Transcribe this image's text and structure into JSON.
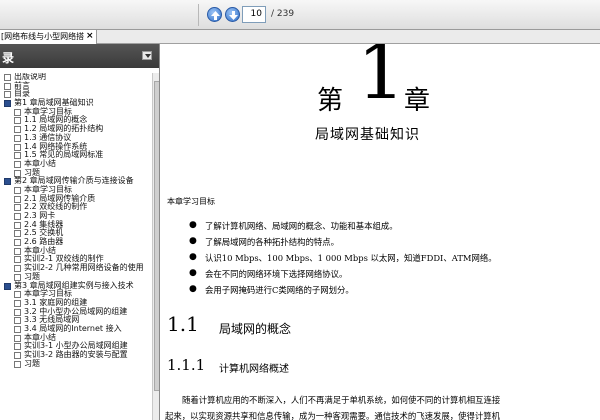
{
  "toolbar": {
    "current_page": "10",
    "page_total": "/ 239"
  },
  "tab": {
    "title": "[网络布线与小型网络搭建]...",
    "close_glyph": "×"
  },
  "sidebar": {
    "title": "录",
    "menu_icon": "triangle-down-icon",
    "items": [
      {
        "label": "出版说明",
        "level": 0,
        "expanded": false
      },
      {
        "label": "前言",
        "level": 0,
        "expanded": false
      },
      {
        "label": "目录",
        "level": 0,
        "expanded": false
      },
      {
        "label": "第1 章局域网基础知识",
        "level": 0,
        "expanded": true
      },
      {
        "label": "本章学习目标",
        "level": 1,
        "expanded": false
      },
      {
        "label": "1.1 局域网的概念",
        "level": 1,
        "expanded": false
      },
      {
        "label": "1.2 局域网的拓扑结构",
        "level": 1,
        "expanded": false
      },
      {
        "label": "1.3 通信协议",
        "level": 1,
        "expanded": false
      },
      {
        "label": "1.4 网络操作系统",
        "level": 1,
        "expanded": false
      },
      {
        "label": "1.5 常见的局域网标准",
        "level": 1,
        "expanded": false
      },
      {
        "label": "本章小结",
        "level": 1,
        "expanded": false
      },
      {
        "label": "习题",
        "level": 1,
        "expanded": false
      },
      {
        "label": "第2 章局域网传输介质与连接设备",
        "level": 0,
        "expanded": true
      },
      {
        "label": "本章学习目标",
        "level": 1,
        "expanded": false
      },
      {
        "label": "2.1 局域网传输介质",
        "level": 1,
        "expanded": false
      },
      {
        "label": "2.2 双绞线的制作",
        "level": 1,
        "expanded": false
      },
      {
        "label": "2.3 网卡",
        "level": 1,
        "expanded": false
      },
      {
        "label": "2.4 集线器",
        "level": 1,
        "expanded": false
      },
      {
        "label": "2.5 交换机",
        "level": 1,
        "expanded": false
      },
      {
        "label": "2.6 路由器",
        "level": 1,
        "expanded": false
      },
      {
        "label": "本章小结",
        "level": 1,
        "expanded": false
      },
      {
        "label": "实训2-1 双绞线的制作",
        "level": 1,
        "expanded": false
      },
      {
        "label": "实训2-2 几种常用网络设备的使用",
        "level": 1,
        "expanded": false
      },
      {
        "label": "习题",
        "level": 1,
        "expanded": false
      },
      {
        "label": "第3 章局域网组建实例与接入技术",
        "level": 0,
        "expanded": true
      },
      {
        "label": "本章学习目标",
        "level": 1,
        "expanded": false
      },
      {
        "label": "3.1 家庭网的组建",
        "level": 1,
        "expanded": false
      },
      {
        "label": "3.2 中小型办公局域网的组建",
        "level": 1,
        "expanded": false
      },
      {
        "label": "3.3 无线局域网",
        "level": 1,
        "expanded": false
      },
      {
        "label": "3.4 局域网的Internet 接入",
        "level": 1,
        "expanded": false
      },
      {
        "label": "本章小结",
        "level": 1,
        "expanded": false
      },
      {
        "label": "实训3-1 小型办公局域网组建",
        "level": 1,
        "expanded": false
      },
      {
        "label": "实训3-2 路由器的安装与配置",
        "level": 1,
        "expanded": false
      },
      {
        "label": "习题",
        "level": 1,
        "expanded": false
      }
    ]
  },
  "document": {
    "chapter_prefix": "第",
    "chapter_number": "1",
    "chapter_suffix": "章",
    "chapter_title": "局域网基础知识",
    "objectives_label": "本章学习目标",
    "objectives": [
      "了解计算机网络、局域网的概念、功能和基本组成。",
      "了解局域网的各种拓扑结构的特点。",
      "认识10 Mbps、100 Mbps、1 000 Mbps 以太网，知道FDDI、ATM网络。",
      "会在不同的网络环境下选择网络协议。",
      "会用子网掩码进行C类网络的子网划分。"
    ],
    "bullet": "●",
    "section_number": "1.1",
    "section_title": "局域网的概念",
    "subsection_number": "1.1.1",
    "subsection_title": "计算机网络概述",
    "paragraph_line1": "随着计算机应用的不断深入，人们不再满足于单机系统，如何使不同的计算机相互连接",
    "paragraph_line2": "起来，以实现资源共享和信息传输，成为一种客观需要。通信技术的飞速发展，使得计算机"
  },
  "colors": {
    "panel_header": "#444444",
    "nav_button": "#2f6fc8",
    "expanded_box": "#2b4f8f"
  }
}
